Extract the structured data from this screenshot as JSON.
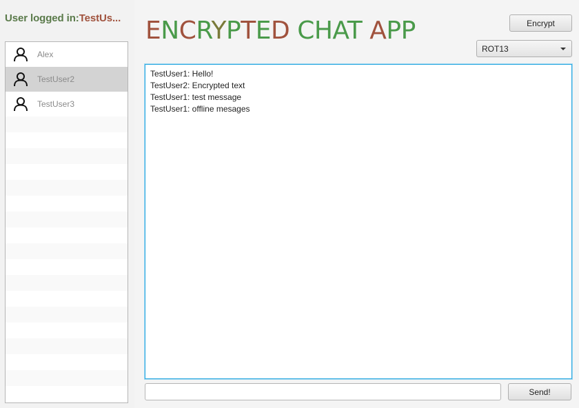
{
  "sidebar": {
    "logged_prefix": "User logged in:",
    "logged_user": "TestUs...",
    "users": [
      {
        "name": "Alex",
        "selected": false,
        "icon": "user-icon"
      },
      {
        "name": "TestUser2",
        "selected": true,
        "icon": "user-icon"
      },
      {
        "name": "TestUser3",
        "selected": false,
        "icon": "user-icon"
      }
    ]
  },
  "header": {
    "title_segments": [
      {
        "text": "E",
        "color": "#a0523d"
      },
      {
        "text": "N",
        "color": "#4a9a4a"
      },
      {
        "text": "C",
        "color": "#a0523d"
      },
      {
        "text": "R",
        "color": "#4a9a4a"
      },
      {
        "text": "Y",
        "color": "#7a7a3a"
      },
      {
        "text": "P",
        "color": "#4a9a4a"
      },
      {
        "text": "T",
        "color": "#a0523d"
      },
      {
        "text": "E",
        "color": "#4a9a4a"
      },
      {
        "text": "D",
        "color": "#a0523d"
      },
      {
        "text": " ",
        "color": "#000000"
      },
      {
        "text": "C",
        "color": "#4a9a4a"
      },
      {
        "text": "H",
        "color": "#4a9a4a"
      },
      {
        "text": "A",
        "color": "#4a9a4a"
      },
      {
        "text": "T",
        "color": "#4a9a4a"
      },
      {
        "text": " ",
        "color": "#000000"
      },
      {
        "text": "A",
        "color": "#a0523d"
      },
      {
        "text": "P",
        "color": "#4a9a4a"
      },
      {
        "text": "P",
        "color": "#4a9a4a"
      }
    ]
  },
  "controls": {
    "encrypt_label": "Encrypt",
    "cipher_selected": "ROT13",
    "send_label": "Send!",
    "message_value": ""
  },
  "chat": {
    "messages": [
      "TestUser1: Hello!",
      "TestUser2: Encrypted text",
      "TestUser1: test message",
      "TestUser1: offline mesages"
    ]
  }
}
